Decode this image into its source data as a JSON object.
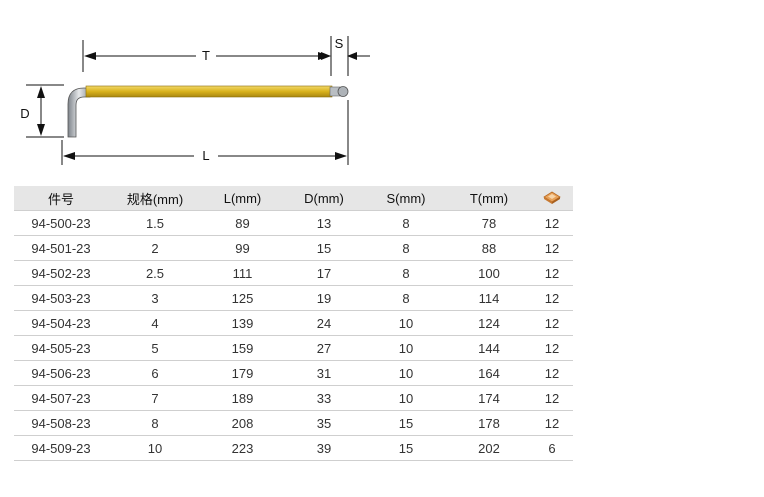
{
  "diagram": {
    "labels": {
      "t": "T",
      "s": "S",
      "d": "D",
      "l": "L"
    },
    "colors": {
      "shaft_gold": "#d9b21c",
      "steel": "#9aa0a6",
      "line": "#111111"
    }
  },
  "table": {
    "headers": {
      "part_no": "件号",
      "size": "规格(mm)",
      "l": "L(mm)",
      "d": "D(mm)",
      "s": "S(mm)",
      "t": "T(mm)",
      "pack_icon": "package-icon"
    },
    "rows": [
      {
        "part_no": "94-500-23",
        "size": "1.5",
        "l": "89",
        "d": "13",
        "s": "8",
        "t": "78",
        "pack": "12"
      },
      {
        "part_no": "94-501-23",
        "size": "2",
        "l": "99",
        "d": "15",
        "s": "8",
        "t": "88",
        "pack": "12"
      },
      {
        "part_no": "94-502-23",
        "size": "2.5",
        "l": "111",
        "d": "17",
        "s": "8",
        "t": "100",
        "pack": "12"
      },
      {
        "part_no": "94-503-23",
        "size": "3",
        "l": "125",
        "d": "19",
        "s": "8",
        "t": "114",
        "pack": "12"
      },
      {
        "part_no": "94-504-23",
        "size": "4",
        "l": "139",
        "d": "24",
        "s": "10",
        "t": "124",
        "pack": "12"
      },
      {
        "part_no": "94-505-23",
        "size": "5",
        "l": "159",
        "d": "27",
        "s": "10",
        "t": "144",
        "pack": "12"
      },
      {
        "part_no": "94-506-23",
        "size": "6",
        "l": "179",
        "d": "31",
        "s": "10",
        "t": "164",
        "pack": "12"
      },
      {
        "part_no": "94-507-23",
        "size": "7",
        "l": "189",
        "d": "33",
        "s": "10",
        "t": "174",
        "pack": "12"
      },
      {
        "part_no": "94-508-23",
        "size": "8",
        "l": "208",
        "d": "35",
        "s": "15",
        "t": "178",
        "pack": "12"
      },
      {
        "part_no": "94-509-23",
        "size": "10",
        "l": "223",
        "d": "39",
        "s": "15",
        "t": "202",
        "pack": "6"
      }
    ]
  }
}
